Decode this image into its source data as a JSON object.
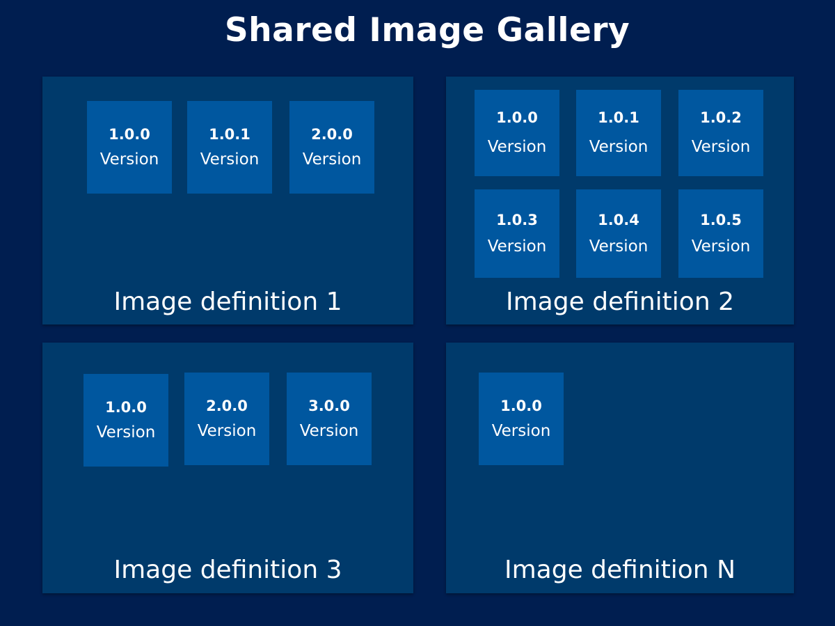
{
  "title": "Shared Image Gallery",
  "colors": {
    "background": "#001e50",
    "panel": "#003a6b",
    "tile": "#00579f",
    "text": "#ffffff"
  },
  "definitions": [
    {
      "label": "Image definition 1",
      "versions": [
        {
          "number": "1.0.0",
          "label": "Version"
        },
        {
          "number": "1.0.1",
          "label": "Version"
        },
        {
          "number": "2.0.0",
          "label": "Version"
        }
      ]
    },
    {
      "label": "Image definition 2",
      "versions": [
        {
          "number": "1.0.0",
          "label": "Version"
        },
        {
          "number": "1.0.1",
          "label": "Version"
        },
        {
          "number": "1.0.2",
          "label": "Version"
        },
        {
          "number": "1.0.3",
          "label": "Version"
        },
        {
          "number": "1.0.4",
          "label": "Version"
        },
        {
          "number": "1.0.5",
          "label": "Version"
        }
      ]
    },
    {
      "label": "Image definition 3",
      "versions": [
        {
          "number": "1.0.0",
          "label": "Version"
        },
        {
          "number": "2.0.0",
          "label": "Version"
        },
        {
          "number": "3.0.0",
          "label": "Version"
        }
      ]
    },
    {
      "label": "Image definition N",
      "versions": [
        {
          "number": "1.0.0",
          "label": "Version"
        }
      ]
    }
  ]
}
